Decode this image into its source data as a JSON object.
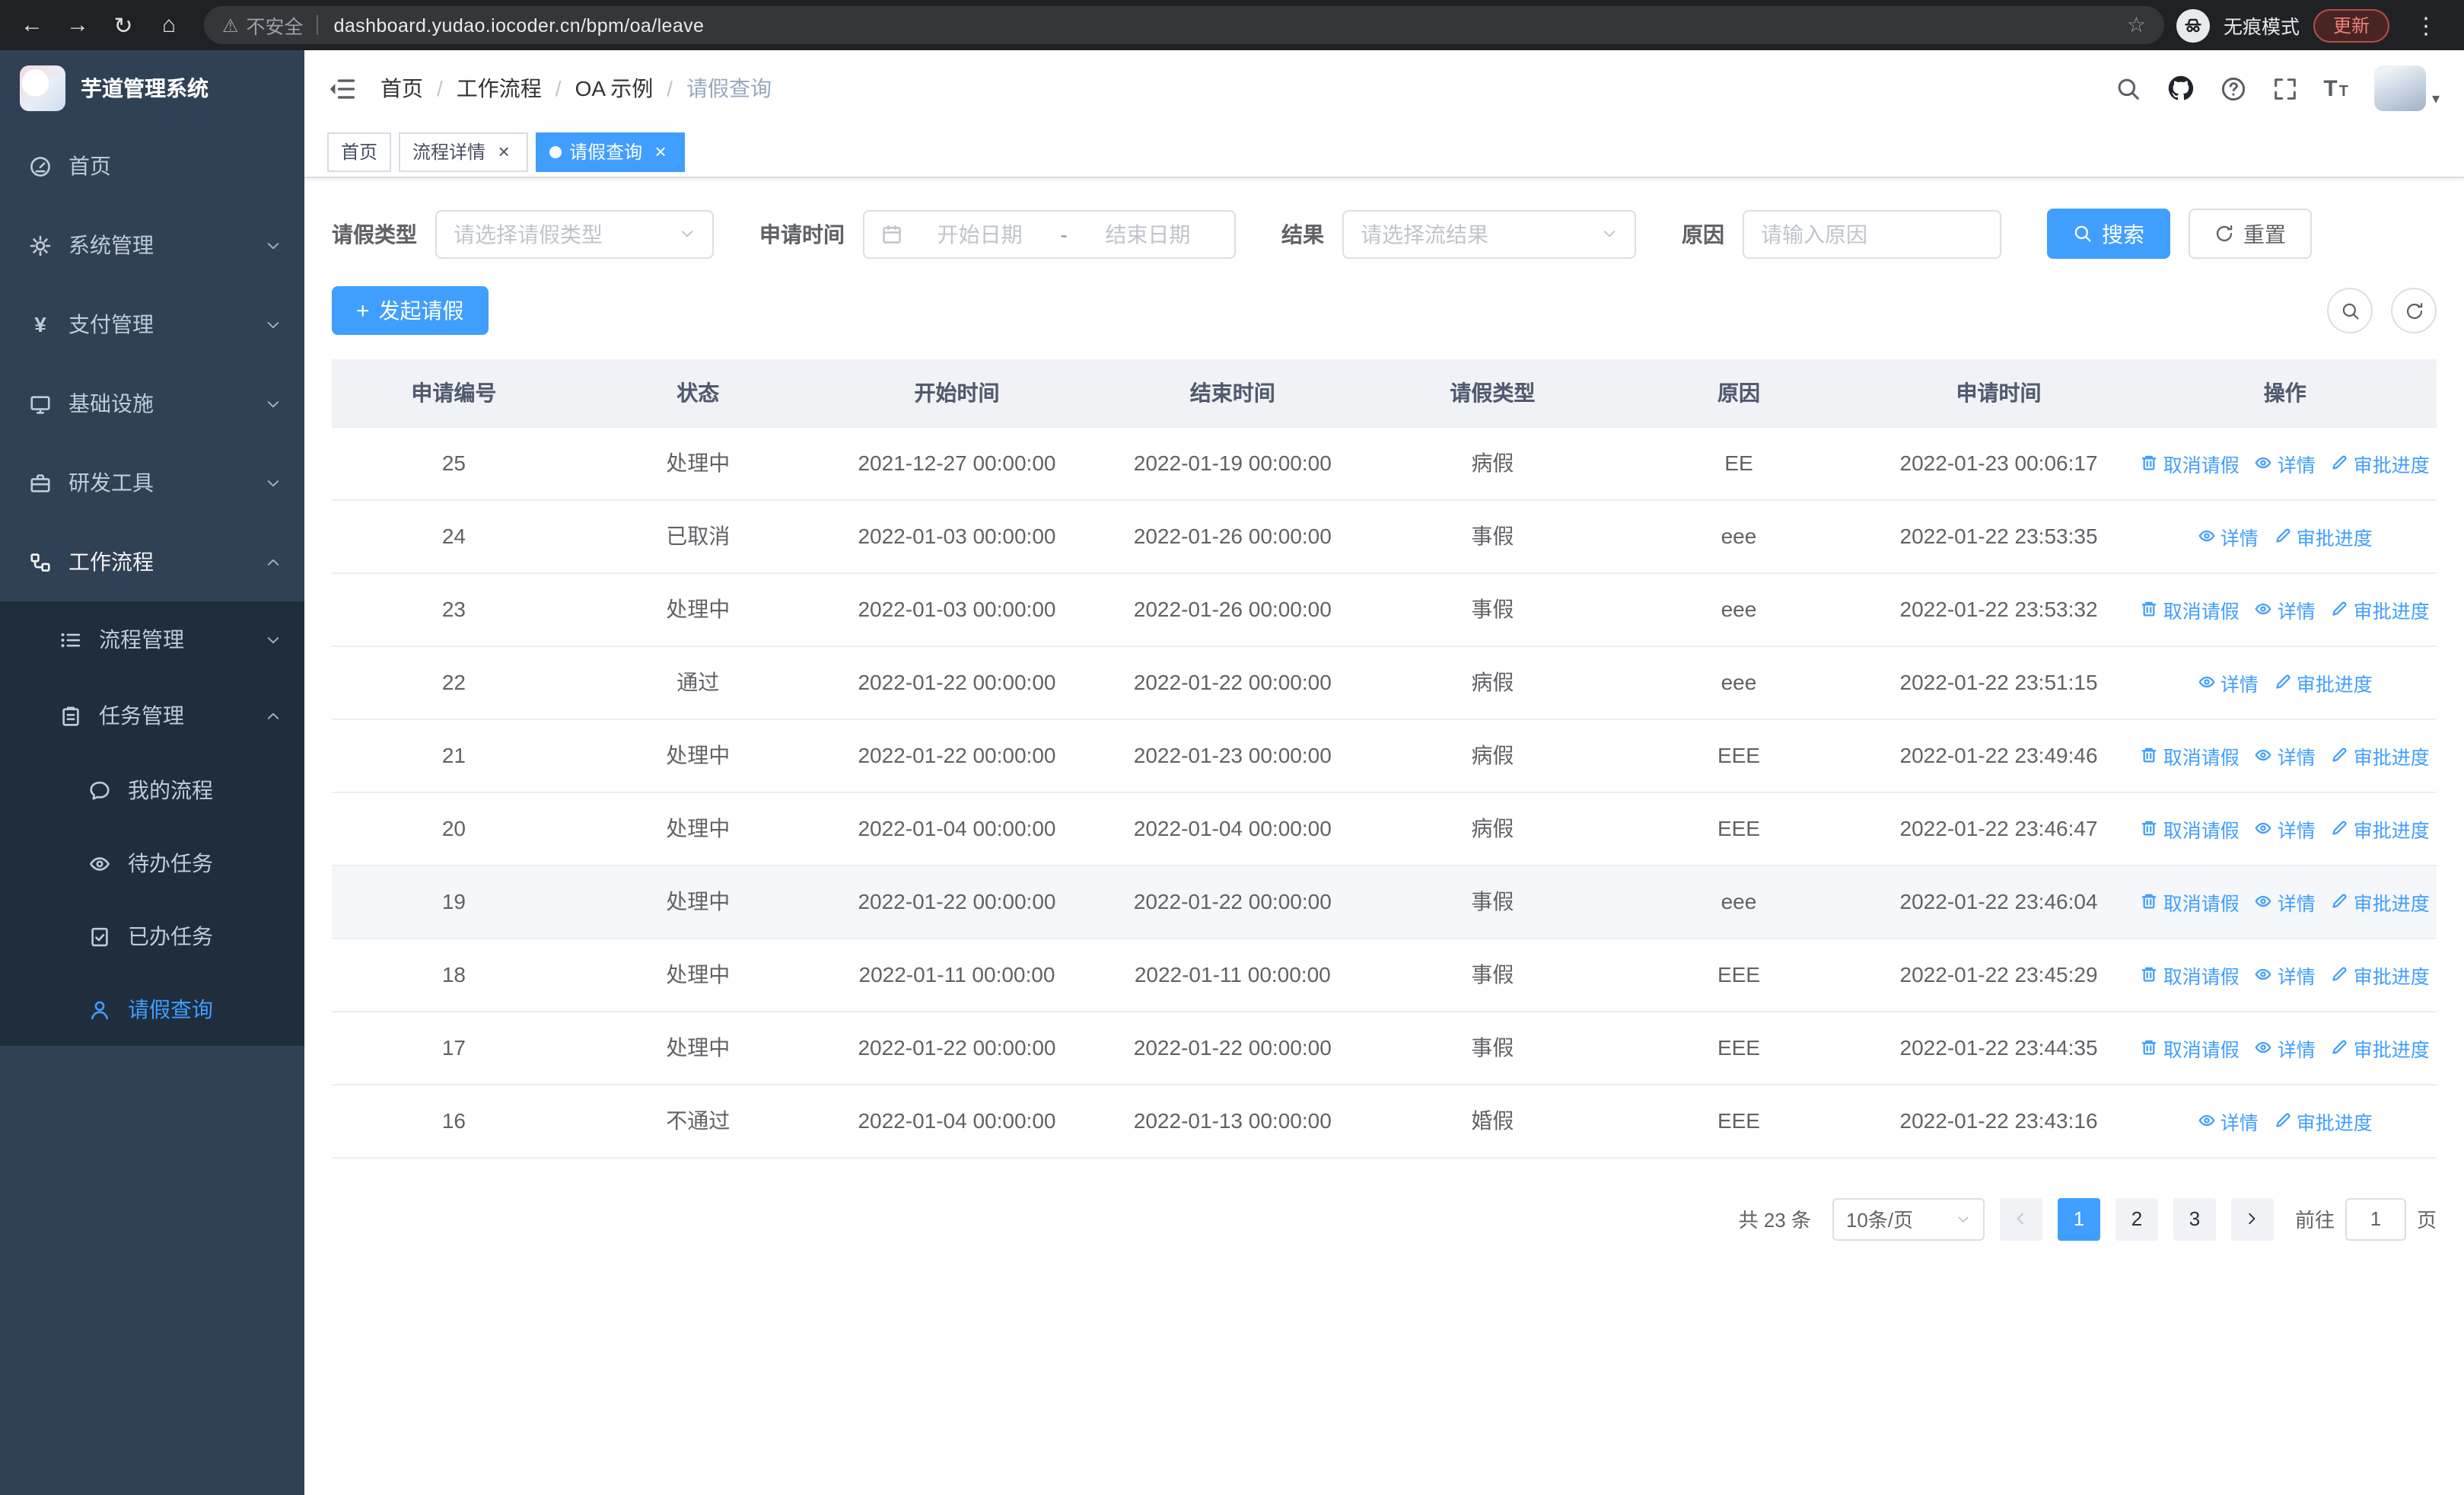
{
  "icons": {
    "back": "←",
    "forward": "→",
    "reload": "↻",
    "home": "⌂",
    "warning": "⚠",
    "star": "☆",
    "dots": "⋮",
    "close": "×",
    "yen": "¥",
    "plus": "+",
    "caret": "▾",
    "font": "T"
  },
  "browser": {
    "security_label": "不安全",
    "url": "dashboard.yudao.iocoder.cn/bpm/oa/leave",
    "incognito_label": "无痕模式",
    "update_label": "更新"
  },
  "sidebar": {
    "title": "芋道管理系统",
    "home": "首页",
    "system": "系统管理",
    "pay": "支付管理",
    "infra": "基础设施",
    "dev": "研发工具",
    "workflow": "工作流程",
    "process": "流程管理",
    "task": "任务管理",
    "myflow": "我的流程",
    "todo": "待办任务",
    "done": "已办任务",
    "leave": "请假查询"
  },
  "breadcrumb": {
    "separator": "/",
    "items": [
      "首页",
      "工作流程",
      "OA 示例",
      "请假查询"
    ]
  },
  "tabs": {
    "items": [
      {
        "label": "首页"
      },
      {
        "label": "流程详情"
      },
      {
        "label": "请假查询"
      }
    ]
  },
  "filters": {
    "leave_type_label": "请假类型",
    "leave_type_placeholder": "请选择请假类型",
    "apply_time_label": "申请时间",
    "start_placeholder": "开始日期",
    "range_separator": "-",
    "end_placeholder": "结束日期",
    "result_label": "结果",
    "result_placeholder": "请选择流结果",
    "reason_label": "原因",
    "reason_placeholder": "请输入原因",
    "search_label": "搜索",
    "reset_label": "重置"
  },
  "toolbar": {
    "create_label": "发起请假"
  },
  "table": {
    "columns": [
      "申请编号",
      "状态",
      "开始时间",
      "结束时间",
      "请假类型",
      "原因",
      "申请时间",
      "操作"
    ],
    "ops": {
      "cancel": "取消请假",
      "detail": "详情",
      "progress": "审批进度"
    },
    "rows": [
      {
        "id": "25",
        "status": "处理中",
        "start": "2021-12-27 00:00:00",
        "end": "2022-01-19 00:00:00",
        "type": "病假",
        "reason": "EE",
        "apply": "2022-01-23 00:06:17",
        "cancel": true
      },
      {
        "id": "24",
        "status": "已取消",
        "start": "2022-01-03 00:00:00",
        "end": "2022-01-26 00:00:00",
        "type": "事假",
        "reason": "eee",
        "apply": "2022-01-22 23:53:35",
        "cancel": false
      },
      {
        "id": "23",
        "status": "处理中",
        "start": "2022-01-03 00:00:00",
        "end": "2022-01-26 00:00:00",
        "type": "事假",
        "reason": "eee",
        "apply": "2022-01-22 23:53:32",
        "cancel": true
      },
      {
        "id": "22",
        "status": "通过",
        "start": "2022-01-22 00:00:00",
        "end": "2022-01-22 00:00:00",
        "type": "病假",
        "reason": "eee",
        "apply": "2022-01-22 23:51:15",
        "cancel": false
      },
      {
        "id": "21",
        "status": "处理中",
        "start": "2022-01-22 00:00:00",
        "end": "2022-01-23 00:00:00",
        "type": "病假",
        "reason": "EEE",
        "apply": "2022-01-22 23:49:46",
        "cancel": true
      },
      {
        "id": "20",
        "status": "处理中",
        "start": "2022-01-04 00:00:00",
        "end": "2022-01-04 00:00:00",
        "type": "病假",
        "reason": "EEE",
        "apply": "2022-01-22 23:46:47",
        "cancel": true
      },
      {
        "id": "19",
        "status": "处理中",
        "start": "2022-01-22 00:00:00",
        "end": "2022-01-22 00:00:00",
        "type": "事假",
        "reason": "eee",
        "apply": "2022-01-22 23:46:04",
        "cancel": true
      },
      {
        "id": "18",
        "status": "处理中",
        "start": "2022-01-11 00:00:00",
        "end": "2022-01-11 00:00:00",
        "type": "事假",
        "reason": "EEE",
        "apply": "2022-01-22 23:45:29",
        "cancel": true
      },
      {
        "id": "17",
        "status": "处理中",
        "start": "2022-01-22 00:00:00",
        "end": "2022-01-22 00:00:00",
        "type": "事假",
        "reason": "EEE",
        "apply": "2022-01-22 23:44:35",
        "cancel": true
      },
      {
        "id": "16",
        "status": "不通过",
        "start": "2022-01-04 00:00:00",
        "end": "2022-01-13 00:00:00",
        "type": "婚假",
        "reason": "EEE",
        "apply": "2022-01-22 23:43:16",
        "cancel": false
      }
    ]
  },
  "pagination": {
    "total": "共 23 条",
    "page_size": "10条/页",
    "pages": [
      "1",
      "2",
      "3"
    ],
    "goto_label": "前往",
    "goto_value": "1",
    "unit_label": "页"
  },
  "colors": {
    "primary": "#409EFF",
    "sidebar_bg": "#304156",
    "submenu_bg": "#1f2d3d"
  }
}
